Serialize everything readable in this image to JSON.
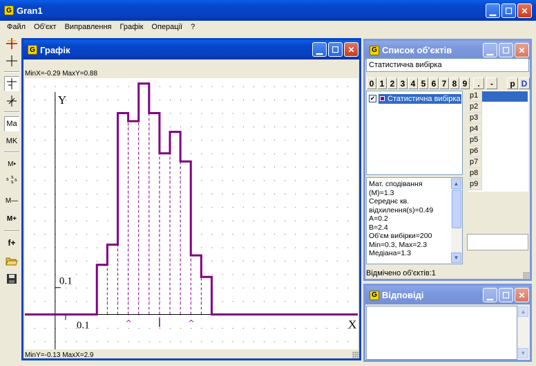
{
  "app": {
    "title": "Gran1"
  },
  "menu": [
    "Файл",
    "Об'єкт",
    "Виправлення",
    "Графік",
    "Операції",
    "?"
  ],
  "toolbar": {
    "icons": [
      "axes-add-icon",
      "crosshair-icon",
      "step-cursor-icon",
      "vertical-cross-icon",
      "mean-icon",
      "median-icon",
      "point-mean-icon",
      "scatter-icon",
      "minus-mean-icon",
      "plus-mean-icon",
      "add-function-icon",
      "open-folder-icon",
      "save-disk-icon"
    ],
    "labels": {
      "ma": "Ma",
      "mk": "MK",
      "mp": "M•",
      "mm": "M—",
      "mplus": "M+",
      "fplus": "f+"
    }
  },
  "graph": {
    "title": "Графік",
    "top_info": "MinX=-0.29  MaxY=0.88",
    "bottom_info": "MinY=-0.13  MaxX=2.9",
    "y_axis_label": "Y",
    "x_axis_label": "X",
    "y_tick": "0.1",
    "x_tick": "0.1",
    "line_color": "#800080"
  },
  "chart_data": {
    "type": "line",
    "subtype": "step",
    "edges": [
      0.3,
      0.4,
      0.5,
      0.6,
      0.7,
      0.8,
      0.9,
      1.0,
      1.1,
      1.2,
      1.3,
      1.4,
      1.5,
      1.6,
      1.7,
      1.8,
      1.9,
      2.0,
      2.1,
      2.2,
      2.3
    ],
    "values": [
      0,
      0.185,
      0.26,
      0.75,
      0.72,
      0.86,
      0.75,
      0.6,
      0.68,
      0.57,
      0.22,
      0.14,
      0
    ],
    "step_edges": [
      0.3,
      0.4,
      0.5,
      0.6,
      0.7,
      0.8,
      0.9,
      1.0,
      1.1,
      1.2,
      1.3,
      1.4,
      1.5
    ],
    "xlim": [
      -0.29,
      2.9
    ],
    "ylim": [
      -0.13,
      0.88
    ],
    "xlabel": "X",
    "ylabel": "Y",
    "x_tick_label": "0.1",
    "y_tick_label": "0.1",
    "markers": [
      {
        "x": 0.7,
        "symbol": "^"
      },
      {
        "x": 1.3,
        "symbol": "^"
      }
    ],
    "median_marker_x": 1.0,
    "grid": true
  },
  "objects": {
    "title": "Список об'єктів",
    "name_field": "Статистична вибірка",
    "digit_buttons": [
      "0",
      "1",
      "2",
      "3",
      "4",
      "5",
      "6",
      "7",
      "8",
      "9",
      ".",
      "-",
      "p",
      "D"
    ],
    "list": [
      {
        "label": "Статистична вибірка",
        "checked": true
      }
    ],
    "params": [
      "p1",
      "p2",
      "p3",
      "p4",
      "p5",
      "p6",
      "p7",
      "p8",
      "p9"
    ],
    "stats": [
      "Мат. сподівання",
      "(M)=1.3",
      "Середнє кв.",
      "відхилення(s)=0.49",
      "A=0.2",
      "B=2.4",
      "Об'єм вибірки=200",
      "Min=0.3, Max=2.3",
      "Медіана=1.3"
    ],
    "status": "Відмічено об'єктів:1"
  },
  "answers": {
    "title": "Відповіді"
  },
  "colors": {
    "titlebar": "#0845c9",
    "selection": "#316ac5",
    "plot": "#800080"
  }
}
